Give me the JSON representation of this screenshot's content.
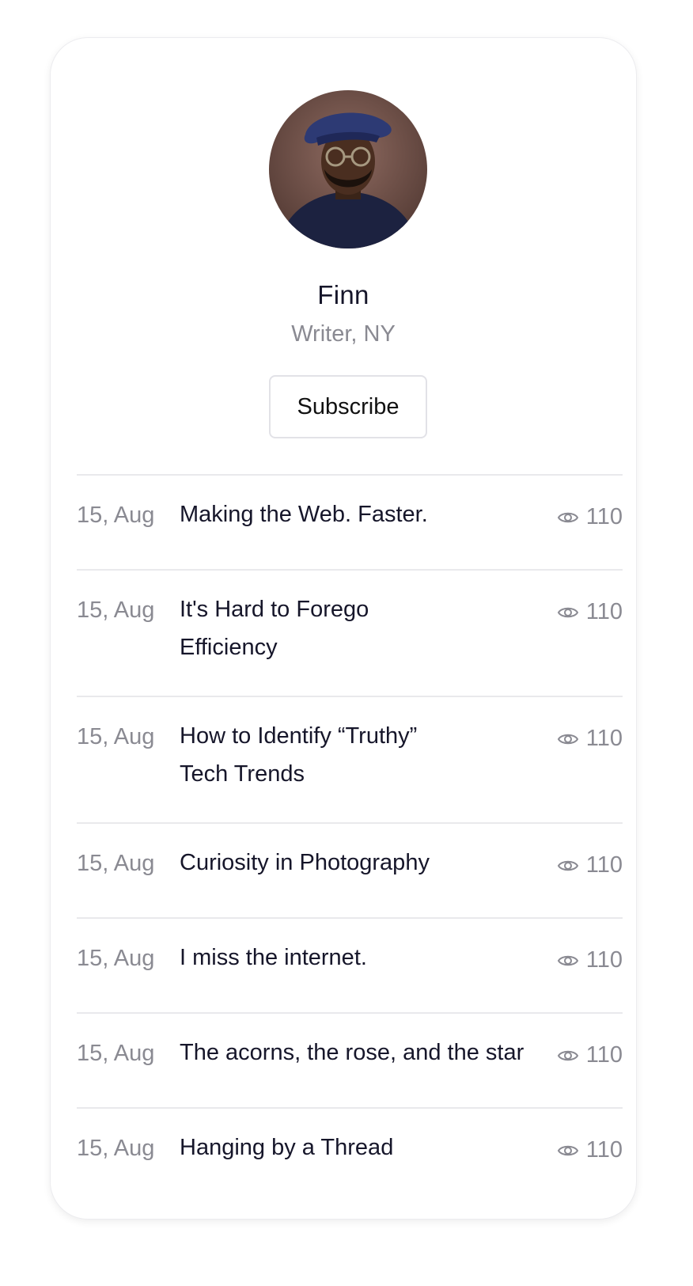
{
  "profile": {
    "name": "Finn",
    "role": "Writer, NY",
    "avatar": "portrait-photo"
  },
  "subscribe_label": "Subscribe",
  "posts": [
    {
      "date": "15, Aug",
      "title": "Making the Web. Faster.",
      "views": "110"
    },
    {
      "date": "15, Aug",
      "title": "It's Hard to Forego Efficiency",
      "views": "110"
    },
    {
      "date": "15, Aug",
      "title": "How to Identify “Truthy” Tech Trends",
      "views": "110"
    },
    {
      "date": "15, Aug",
      "title": "Curiosity in Photography",
      "views": "110"
    },
    {
      "date": "15, Aug",
      "title": "I miss the internet.",
      "views": "110"
    },
    {
      "date": "15, Aug",
      "title": "The acorns, the rose, and the star",
      "views": "110"
    },
    {
      "date": "15, Aug",
      "title": "Hanging by a Thread",
      "views": "110"
    }
  ],
  "icons": {
    "views": "eye-icon"
  },
  "colors": {
    "text": "#16162a",
    "muted": "#8a8a92",
    "divider": "#e9e9ec"
  }
}
